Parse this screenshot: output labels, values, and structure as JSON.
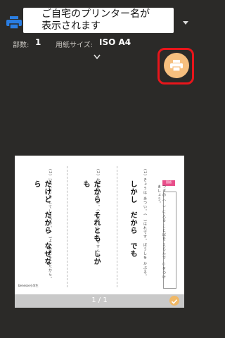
{
  "printer": {
    "name": "ご自宅のプリンター名が\n表示されます"
  },
  "settings": {
    "copies_label": "部数:",
    "copies_value": "1",
    "paper_label": "用紙サイズ:",
    "paper_value": "ISO A4"
  },
  "preview": {
    "page_counter": "1 / 1",
    "badge": "国語",
    "footer_logo": "benesse小学生",
    "questions": [
      {
        "num": "(1)",
        "text": "きょうは あつい。(　)はれです。ぼうしを かぶる。",
        "options": "しかし　だから　でも"
      },
      {
        "num": "(2)",
        "text": "かぜを ひいた。(　)がっこうを やすんだ。",
        "options": "だから　それとも　しかも"
      },
      {
        "num": "(3)",
        "text": "いねむりを してしまった。(　)よふかしをしたから。",
        "options": "だけど　だから　なぜなら"
      }
    ],
    "instruction": "つぎの（　）に入る ことばを えらんで ○をつけましょう。"
  },
  "colors": {
    "accent": "#f6bf7e",
    "highlight": "#e8151b",
    "printer_icon": "#2a7de1"
  },
  "icons": {
    "printer": "printer-icon",
    "dropdown": "chevron-down-icon",
    "expand": "chevron-down-icon",
    "print": "print-fab-icon",
    "check": "check-icon"
  }
}
